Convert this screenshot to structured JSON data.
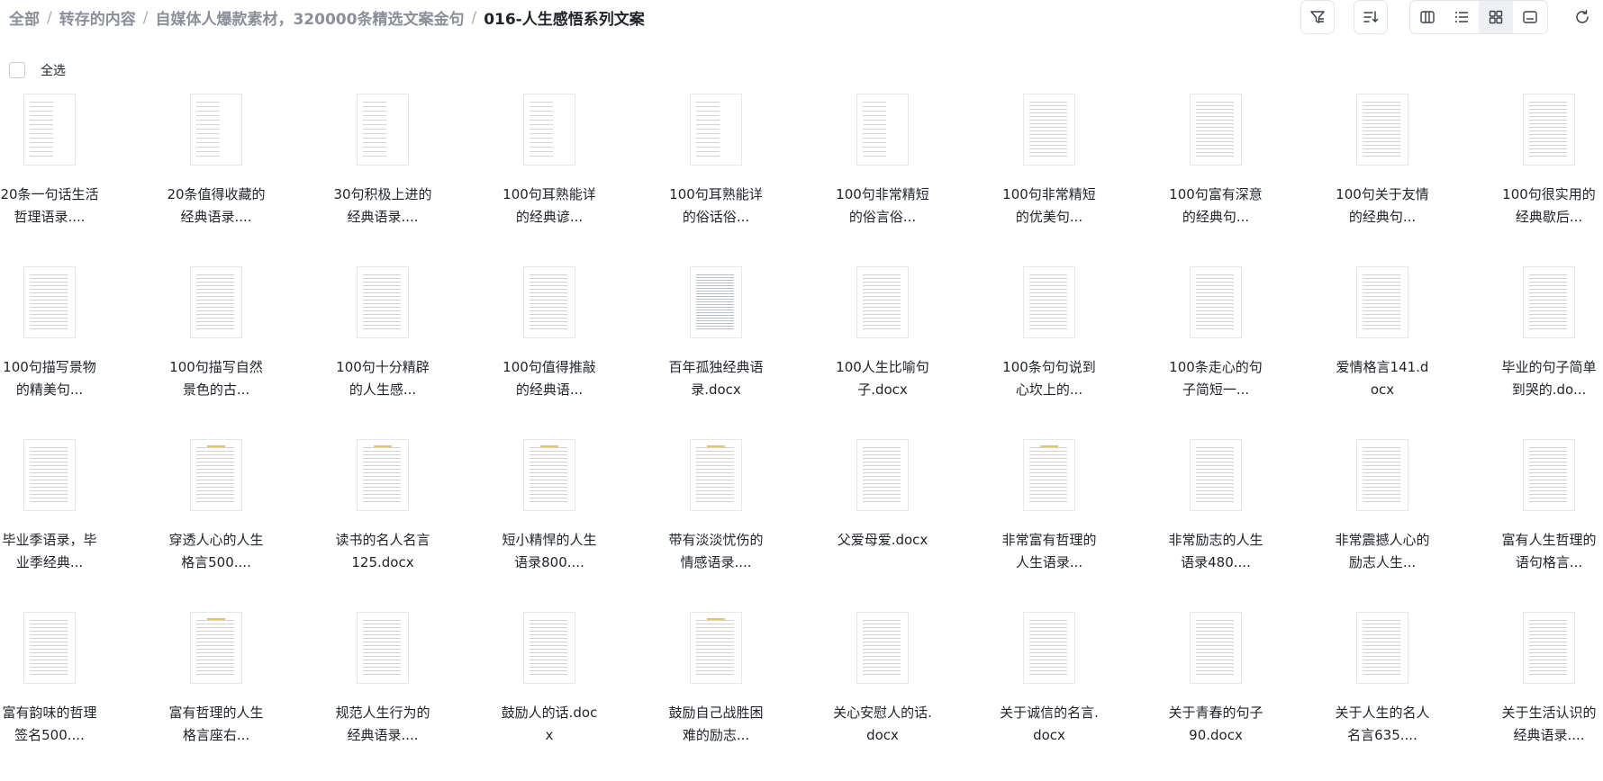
{
  "breadcrumb": [
    "全部",
    "转存的内容",
    "自媒体人爆款素材，320000条精选文案金句",
    "016-人生感悟系列文案"
  ],
  "toolbar": {
    "filter_icon": "filter-icon",
    "sort_icon": "sort-icon",
    "views": [
      "split-view-icon",
      "list-view-icon",
      "grid-view-icon",
      "card-view-icon"
    ],
    "active_view": "grid-view-icon",
    "refresh_icon": "refresh-icon"
  },
  "select_all_label": "全选",
  "files": [
    "20条一句话生活哲理语录....",
    "20条值得收藏的经典语录....",
    "30句积极上进的经典语录....",
    "100句耳熟能详的经典谚...",
    "100句耳熟能详的俗话俗...",
    "100句非常精短的俗言俗...",
    "100句非常精短的优美句...",
    "100句富有深意的经典句...",
    "100句关于友情的经典句...",
    "100句很实用的经典歇后...",
    "100句描写景物的精美句...",
    "100句描写自然景色的古...",
    "100句十分精辟的人生感...",
    "100句值得推敲的经典语...",
    "百年孤独经典语录.docx",
    "100人生比喻句子.docx",
    "100条句句说到心坎上的...",
    "100条走心的句子简短一...",
    "爱情格言141.docx",
    "毕业的句子简单到哭的.do...",
    "毕业季语录，毕业季经典...",
    "穿透人心的人生格言500....",
    "读书的名人名言125.docx",
    "短小精悍的人生语录800....",
    "带有淡淡忧伤的情感语录....",
    "父爱母爱.docx",
    "非常富有哲理的人生语录...",
    "非常励志的人生语录480....",
    "非常震撼人心的励志人生...",
    "富有人生哲理的语句格言...",
    "富有韵味的哲理签名500....",
    "富有哲理的人生格言座右...",
    "规范人生行为的经典语录....",
    "鼓励人的话.docx",
    "鼓励自己战胜困难的励志...",
    "关心安慰人的话.docx",
    "关于诚信的名言.docx",
    "关于青春的句子90.docx",
    "关于人生的名人名言635....",
    "关于生活认识的经典语录...."
  ]
}
